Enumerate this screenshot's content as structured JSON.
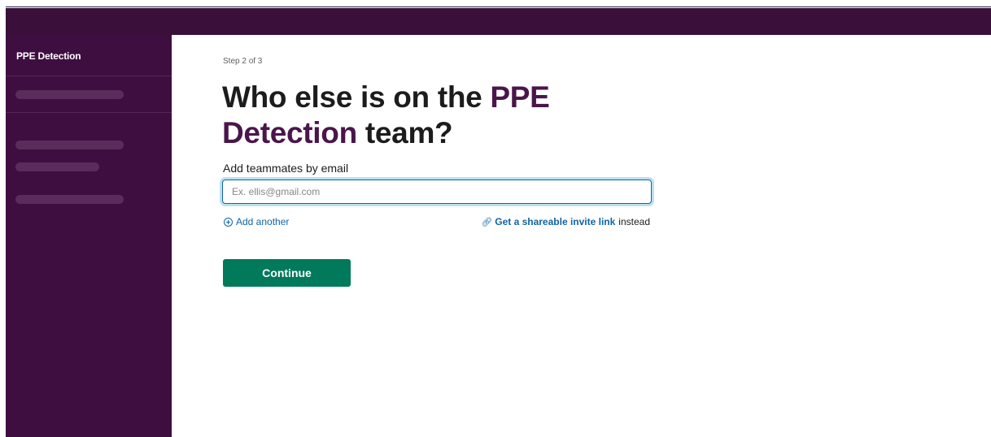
{
  "sidebar": {
    "workspace_name": "PPE Detection"
  },
  "main": {
    "step": "Step 2 of 3",
    "heading_prefix": "Who else is on the ",
    "heading_team": "PPE Detection",
    "heading_suffix": " team?",
    "email_label": "Add teammates by email",
    "email_placeholder": "Ex. ellis@gmail.com",
    "email_value": "",
    "add_another": "Add another",
    "invite_link": "Get a shareable invite link",
    "invite_suffix": "instead",
    "continue_label": "Continue"
  },
  "colors": {
    "topbar": "#3a0f3a",
    "sidebar": "#3f0e40",
    "accent": "#4a154b",
    "link": "#1264a3",
    "primary_button": "#007a5a"
  },
  "icons": {
    "add": "plus-circle-icon",
    "invite": "link-icon"
  }
}
